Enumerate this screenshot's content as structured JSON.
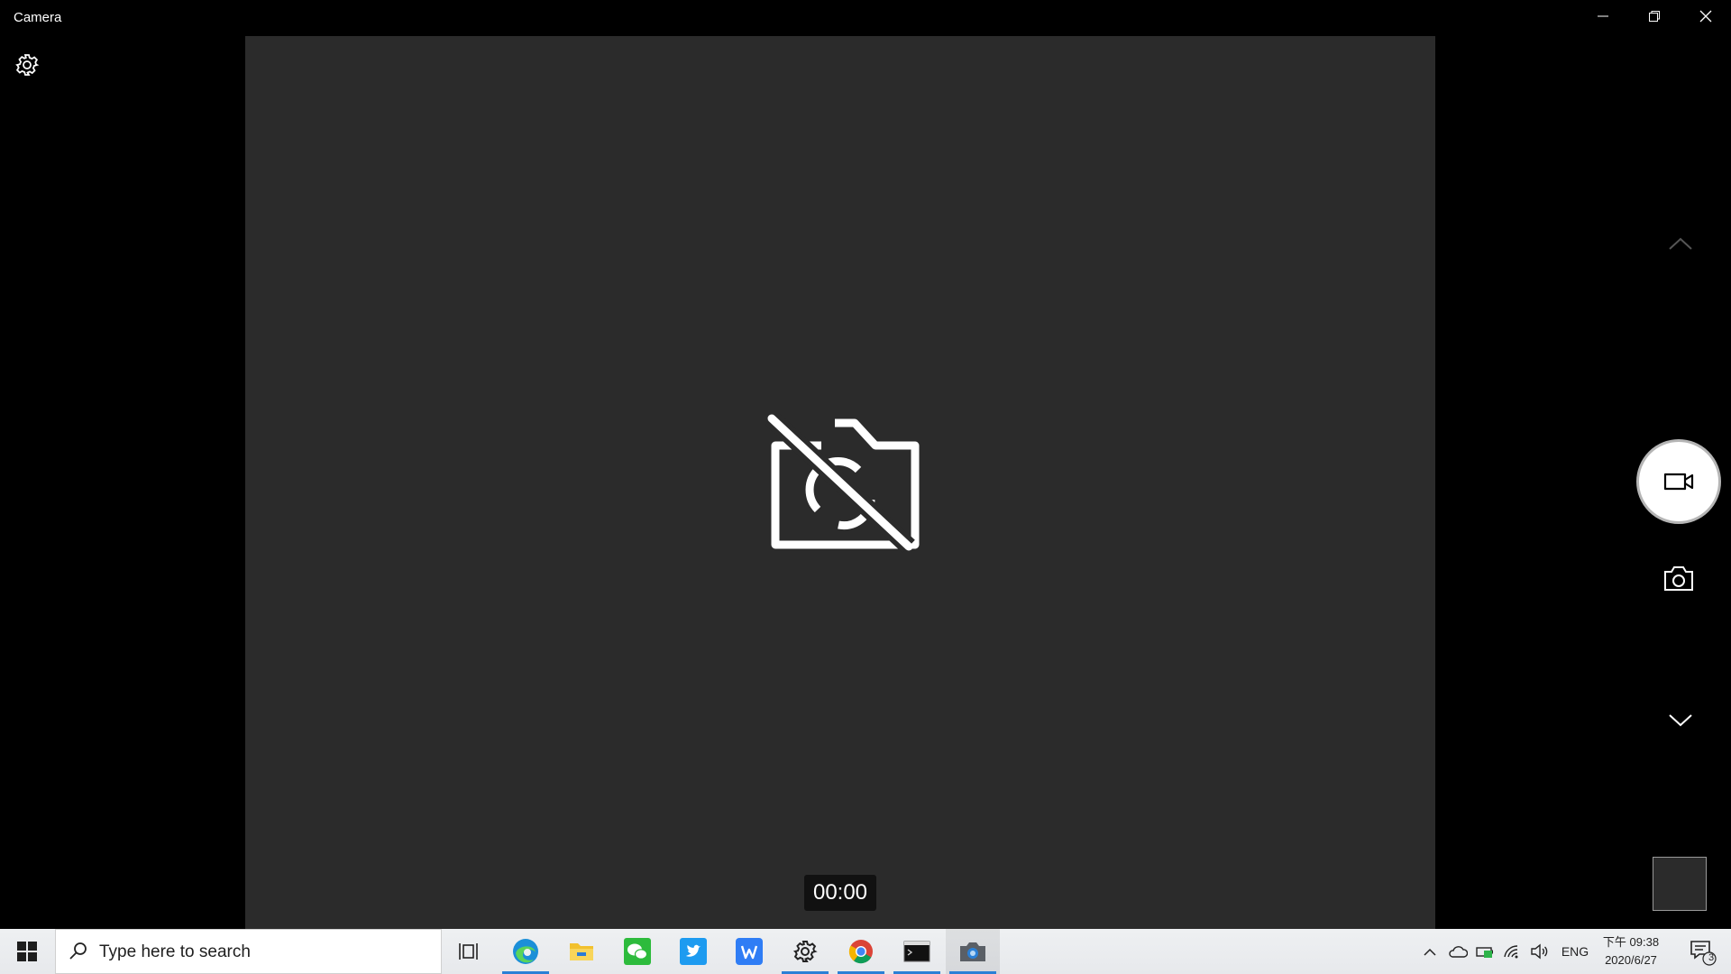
{
  "window": {
    "title": "Camera"
  },
  "titlebar": {
    "minimize_icon": "minimize-icon",
    "restore_icon": "restore-icon",
    "close_icon": "close-icon"
  },
  "camera": {
    "settings_icon": "gear-icon",
    "status_icon": "camera-off-icon",
    "timer": "00:00",
    "controls": {
      "up_icon": "chevron-up-icon",
      "record_icon": "video-camera-icon",
      "photo_icon": "camera-icon",
      "down_icon": "chevron-down-icon"
    }
  },
  "taskbar": {
    "search_placeholder": "Type here to search",
    "apps": [
      {
        "name": "task-view",
        "icon": "task-view-icon"
      },
      {
        "name": "edge",
        "icon": "edge-icon"
      },
      {
        "name": "file-explorer",
        "icon": "folder-icon"
      },
      {
        "name": "wechat",
        "icon": "wechat-icon"
      },
      {
        "name": "twitter",
        "icon": "twitter-icon"
      },
      {
        "name": "wps",
        "icon": "wps-icon"
      },
      {
        "name": "settings",
        "icon": "gear-icon"
      },
      {
        "name": "chrome",
        "icon": "chrome-icon"
      },
      {
        "name": "terminal",
        "icon": "terminal-icon"
      },
      {
        "name": "camera",
        "icon": "camera-icon"
      }
    ],
    "tray": {
      "language": "ENG",
      "time": "下午 09:38",
      "date": "2020/6/27",
      "notification_count": "3"
    }
  },
  "colors": {
    "accent": "#2b80d6",
    "viewport": "#2b2b2b",
    "background": "#000000"
  }
}
